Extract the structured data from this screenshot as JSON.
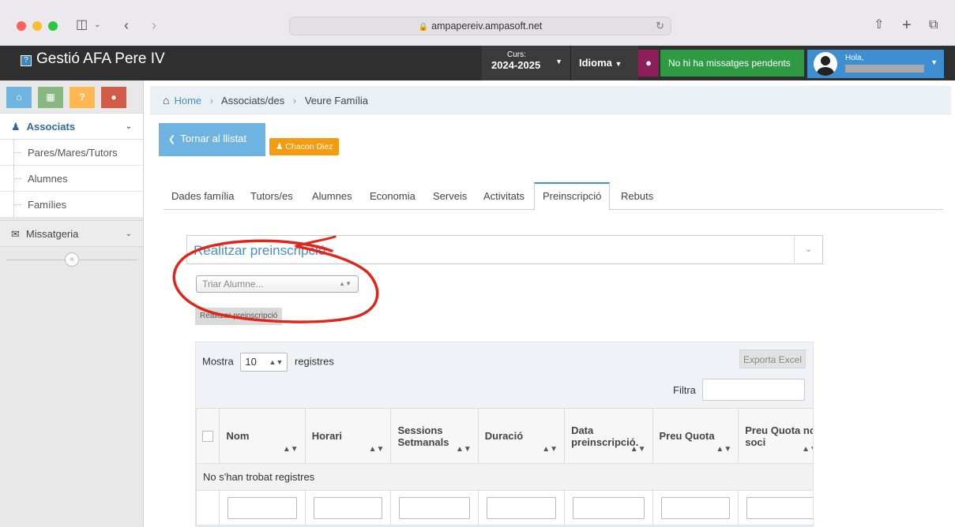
{
  "browser": {
    "url": "ampapereiv.ampasoft.net",
    "icons": [
      "sidebar-icon",
      "back-icon",
      "forward-icon",
      "reload-icon",
      "share-icon",
      "new-tab-icon",
      "tabs-icon"
    ]
  },
  "header": {
    "app_title": "Gestió AFA Pere IV",
    "curs_label": "Curs:",
    "curs_value": "2024-2025",
    "idioma": "Idioma",
    "messages": "No hi ha missatges pendents",
    "greeting": "Hola,",
    "colors": {
      "bar": "#2f2f2f",
      "globe": "#8e1e5c",
      "messages": "#2e9b44",
      "user": "#3e8fd2"
    }
  },
  "sidebar": {
    "shortcut_icons": [
      "home-icon",
      "calendar-icon",
      "help-icon",
      "chat-icon"
    ],
    "help_label": "?",
    "section": "Associats",
    "items": [
      "Pares/Mares/Tutors",
      "Alumnes",
      "Famílies"
    ],
    "section2": "Missatgeria"
  },
  "breadcrumb": {
    "home": "Home",
    "level2": "Associats/des",
    "level3": "Veure Família"
  },
  "actions": {
    "back": "Tornar al llistat",
    "family_badge": "Chacon Diez"
  },
  "tabs": [
    "Dades família",
    "Tutors/es",
    "Alumnes",
    "Economia",
    "Serveis",
    "Activitats",
    "Preinscripció",
    "Rebuts"
  ],
  "active_tab": "Preinscripció",
  "panel": {
    "title": "Realitzar preinscripció",
    "select_placeholder": "Triar Alumne...",
    "submit": "Realitzar preinscripció"
  },
  "table": {
    "show_label": "Mostra",
    "page_size": "10",
    "records_label": "registres",
    "export": "Exporta Excel",
    "filter_label": "Filtra",
    "columns": [
      "Nom",
      "Horari",
      "Sessions Setmanals",
      "Duració",
      "Data preinscripció.",
      "Preu Quota",
      "Preu Quota no soci"
    ],
    "empty_message": "No s'han trobat registres"
  }
}
